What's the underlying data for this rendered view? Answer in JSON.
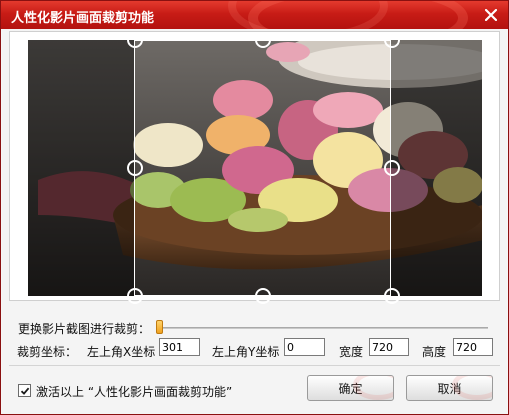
{
  "window": {
    "title": "人性化影片画面裁剪功能",
    "close_icon": "close-icon"
  },
  "crop": {
    "slider_label": "更换影片截图进行裁剪：",
    "slider_position_fraction": 0.0,
    "coords_label": "裁剪坐标：",
    "x_label": "左上角X坐标",
    "x_value": "301",
    "y_label": "左上角Y坐标",
    "y_value": "0",
    "width_label": "宽度",
    "width_value": "720",
    "height_label": "高度",
    "height_value": "720"
  },
  "footer": {
    "activate_checked": true,
    "activate_label": "激活以上 “人性化影片画面裁剪功能”",
    "ok_label": "确定",
    "cancel_label": "取消"
  },
  "colors": {
    "titlebar": "#c81c16",
    "slider_thumb": "#f0a21f"
  }
}
